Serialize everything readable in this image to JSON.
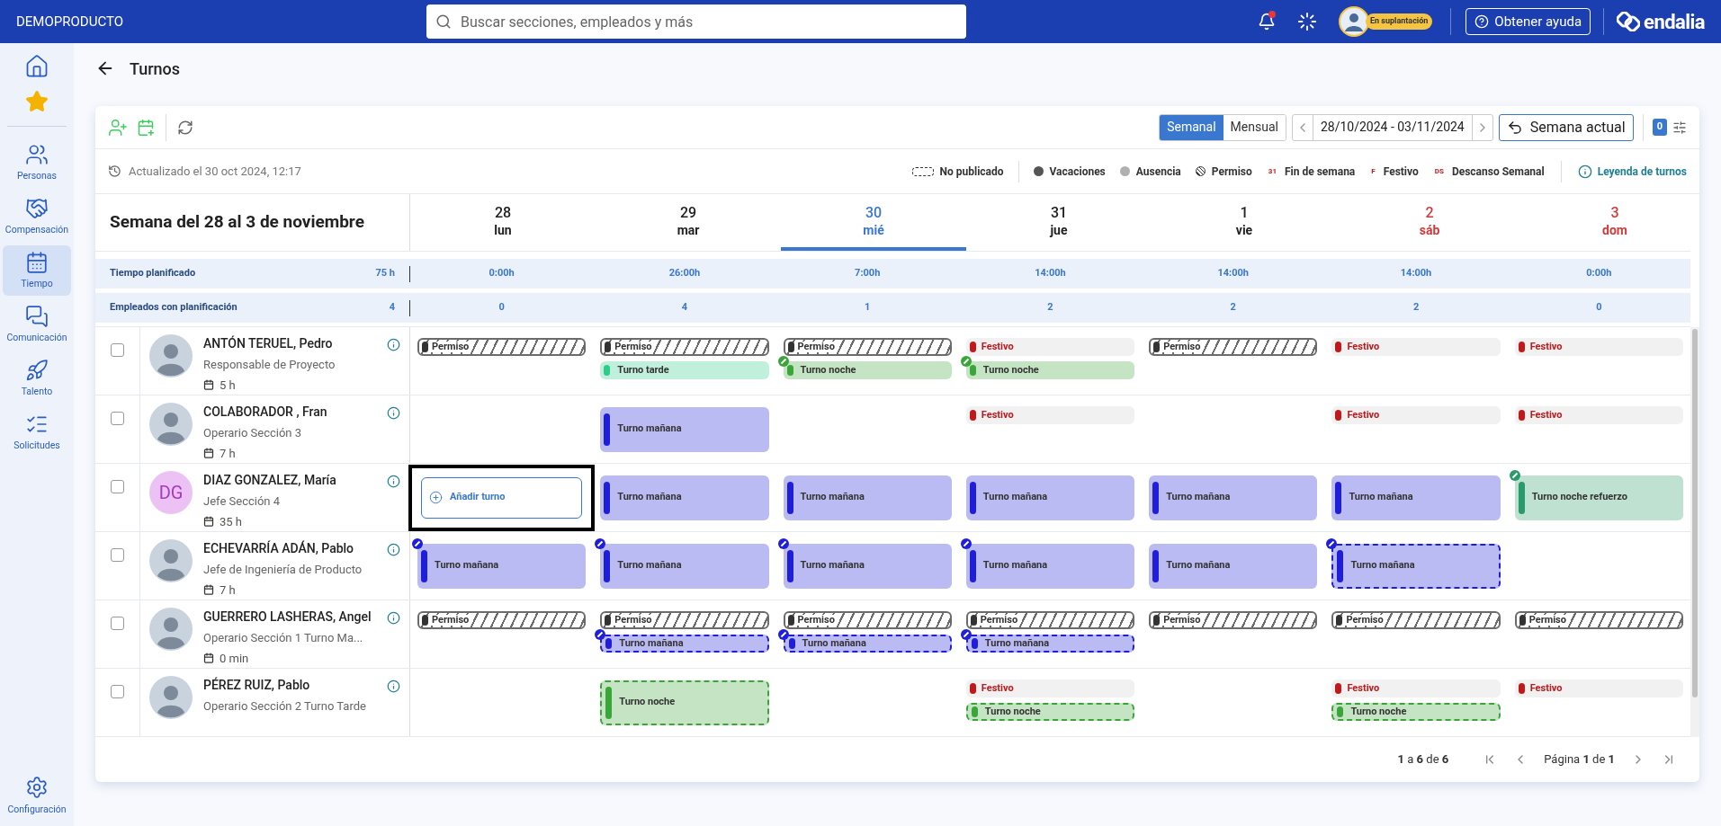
{
  "topbar": {
    "brand": "DEMOPRODUCTO",
    "search_placeholder": "Buscar secciones, empleados y más",
    "notifications": true,
    "impersonation_badge": "En suplantación",
    "help_button": "Obtener ayuda",
    "logo_text": "endalia"
  },
  "sidebar": {
    "items": [
      {
        "label": "Personas",
        "selected": false
      },
      {
        "label": "Compensación",
        "selected": false
      },
      {
        "label": "Tiempo",
        "selected": true
      },
      {
        "label": "Comunicación",
        "selected": false
      },
      {
        "label": "Talento",
        "selected": false
      },
      {
        "label": "Solicitudes",
        "selected": false
      }
    ],
    "footer": "Configuración"
  },
  "page": {
    "title": "Turnos"
  },
  "toolbar": {
    "views": [
      {
        "label": "Semanal",
        "selected": true
      },
      {
        "label": "Mensual",
        "selected": false
      }
    ],
    "date_range": "28/10/2024 - 03/11/2024",
    "current_week_button": "Semana actual",
    "filter_count": "0"
  },
  "updated": "Actualizado el 30 oct 2024, 12:17",
  "legend": [
    {
      "kind": "dashed",
      "label": "No publicado"
    },
    {
      "kind": "dot",
      "label": "Vacaciones",
      "color": "#555555"
    },
    {
      "kind": "dot",
      "label": "Ausencia",
      "color": "#b0b0b0"
    },
    {
      "kind": "hatch",
      "label": "Permiso"
    },
    {
      "kind": "mark",
      "mark": "31",
      "label": "Fin de semana"
    },
    {
      "kind": "mark",
      "mark": "F",
      "label": "Festivo"
    },
    {
      "kind": "mark",
      "mark": "DS",
      "label": "Descanso Semanal"
    }
  ],
  "legend_link": "Leyenda de turnos",
  "week": {
    "title": "Semana del 28 al 3 de noviembre",
    "days": [
      {
        "number": "28",
        "name": "lun",
        "today": false,
        "weekend": false
      },
      {
        "number": "29",
        "name": "mar",
        "today": false,
        "weekend": false
      },
      {
        "number": "30",
        "name": "mié",
        "today": true,
        "weekend": false
      },
      {
        "number": "31",
        "name": "jue",
        "today": false,
        "weekend": false
      },
      {
        "number": "1",
        "name": "vie",
        "today": false,
        "weekend": false
      },
      {
        "number": "2",
        "name": "sáb",
        "today": false,
        "weekend": true
      },
      {
        "number": "3",
        "name": "dom",
        "today": false,
        "weekend": true
      }
    ]
  },
  "stats": [
    {
      "label": "Tiempo planificado",
      "total": "75 h",
      "values": [
        "0:00h",
        "26:00h",
        "7:00h",
        "14:00h",
        "14:00h",
        "14:00h",
        "0:00h"
      ]
    },
    {
      "label": "Empleados con planificación",
      "total": "4",
      "values": [
        "0",
        "4",
        "1",
        "2",
        "2",
        "2",
        "0"
      ]
    }
  ],
  "employees": [
    {
      "name": "ANTÓN TERUEL, Pedro",
      "role": "Responsable de Proyecto",
      "hours": "5 h",
      "avatar": {
        "kind": "photo"
      },
      "checked": false,
      "days": {
        "day_1": [
          {
            "kind": "permiso",
            "label": "Permiso"
          }
        ],
        "day_2": [
          {
            "kind": "permiso",
            "label": "Permiso"
          },
          {
            "kind": "shift",
            "label": "Turno tarde",
            "color": "#2ecc8a",
            "published": true,
            "edited": false
          }
        ],
        "day_3": [
          {
            "kind": "permiso",
            "label": "Permiso"
          },
          {
            "kind": "shift",
            "label": "Turno noche",
            "color": "#3aa63a",
            "published": true,
            "edited": true
          }
        ],
        "day_4": [
          {
            "kind": "festivo",
            "label": "Festivo"
          },
          {
            "kind": "shift",
            "label": "Turno noche",
            "color": "#3aa63a",
            "published": true,
            "edited": true
          }
        ],
        "day_5": [
          {
            "kind": "permiso",
            "label": "Permiso"
          }
        ],
        "day_6": [
          {
            "kind": "festivo",
            "label": "Festivo"
          }
        ],
        "day_7": [
          {
            "kind": "festivo",
            "label": "Festivo"
          }
        ]
      }
    },
    {
      "name": "COLABORADOR , Fran",
      "role": "Operario Sección 3",
      "hours": "7 h",
      "avatar": {
        "kind": "photo"
      },
      "checked": false,
      "days": {
        "day_2": [
          {
            "kind": "shift",
            "label": "Turno mañana",
            "color": "#1f1fdb",
            "published": true,
            "edited": false
          }
        ],
        "day_4": [
          {
            "kind": "festivo",
            "label": "Festivo"
          }
        ],
        "day_6": [
          {
            "kind": "festivo",
            "label": "Festivo"
          }
        ],
        "day_7": [
          {
            "kind": "festivo",
            "label": "Festivo"
          }
        ]
      }
    },
    {
      "name": "DIAZ GONZALEZ, María",
      "role": "Jefe Sección 4",
      "hours": "35 h",
      "avatar": {
        "kind": "initials",
        "text": "DG"
      },
      "checked": false,
      "days": {
        "day_1": [
          {
            "kind": "add",
            "label": "Añadir turno",
            "focused": true
          }
        ],
        "day_2": [
          {
            "kind": "shift",
            "label": "Turno mañana",
            "color": "#1f1fdb",
            "published": true,
            "edited": false
          }
        ],
        "day_3": [
          {
            "kind": "shift",
            "label": "Turno mañana",
            "color": "#1f1fdb",
            "published": true,
            "edited": false
          }
        ],
        "day_4": [
          {
            "kind": "shift",
            "label": "Turno mañana",
            "color": "#1f1fdb",
            "published": true,
            "edited": false
          }
        ],
        "day_5": [
          {
            "kind": "shift",
            "label": "Turno mañana",
            "color": "#1f1fdb",
            "published": true,
            "edited": false
          }
        ],
        "day_6": [
          {
            "kind": "shift",
            "label": "Turno mañana",
            "color": "#1f1fdb",
            "published": true,
            "edited": false
          }
        ],
        "day_7": [
          {
            "kind": "shift",
            "label": "Turno noche refuerzo",
            "color": "#2a9a6a",
            "published": true,
            "edited": true
          }
        ]
      }
    },
    {
      "name": "ECHEVARRÍA ADÁN, Pablo",
      "role": "Jefe de Ingeniería de Producto",
      "hours": "7 h",
      "avatar": {
        "kind": "photo"
      },
      "checked": false,
      "days": {
        "day_1": [
          {
            "kind": "shift",
            "label": "Turno mañana",
            "color": "#1f1fdb",
            "published": true,
            "edited": true
          }
        ],
        "day_2": [
          {
            "kind": "shift",
            "label": "Turno mañana",
            "color": "#1f1fdb",
            "published": true,
            "edited": true
          }
        ],
        "day_3": [
          {
            "kind": "shift",
            "label": "Turno mañana",
            "color": "#1f1fdb",
            "published": true,
            "edited": true
          }
        ],
        "day_4": [
          {
            "kind": "shift",
            "label": "Turno mañana",
            "color": "#1f1fdb",
            "published": true,
            "edited": true
          }
        ],
        "day_5": [
          {
            "kind": "shift",
            "label": "Turno mañana",
            "color": "#1f1fdb",
            "published": true,
            "edited": false
          }
        ],
        "day_6": [
          {
            "kind": "shift",
            "label": "Turno mañana",
            "color": "#1f1fdb",
            "published": false,
            "edited": true
          }
        ]
      }
    },
    {
      "name": "GUERRERO LASHERAS, Angel",
      "role": "Operario Sección 1 Turno Ma...",
      "hours": "0 min",
      "avatar": {
        "kind": "photo"
      },
      "checked": false,
      "days": {
        "day_1": [
          {
            "kind": "permiso",
            "label": "Permiso"
          }
        ],
        "day_2": [
          {
            "kind": "permiso",
            "label": "Permiso"
          },
          {
            "kind": "shift",
            "label": "Turno mañana",
            "color": "#1f1fdb",
            "published": false,
            "edited": true
          }
        ],
        "day_3": [
          {
            "kind": "permiso",
            "label": "Permiso"
          },
          {
            "kind": "shift",
            "label": "Turno mañana",
            "color": "#1f1fdb",
            "published": false,
            "edited": true
          }
        ],
        "day_4": [
          {
            "kind": "permiso",
            "label": "Permiso"
          },
          {
            "kind": "shift",
            "label": "Turno mañana",
            "color": "#1f1fdb",
            "published": false,
            "edited": true
          }
        ],
        "day_5": [
          {
            "kind": "permiso",
            "label": "Permiso"
          }
        ],
        "day_6": [
          {
            "kind": "permiso",
            "label": "Permiso"
          }
        ],
        "day_7": [
          {
            "kind": "permiso",
            "label": "Permiso"
          }
        ]
      }
    },
    {
      "name": "PÉREZ RUIZ, Pablo",
      "role": "Operario Sección 2 Turno Tarde",
      "avatar": {
        "kind": "photo"
      },
      "checked": false,
      "days": {
        "day_2": [
          {
            "kind": "shift",
            "label": "Turno noche",
            "color": "#3aa63a",
            "published": false,
            "edited": false
          }
        ],
        "day_4": [
          {
            "kind": "festivo",
            "label": "Festivo"
          },
          {
            "kind": "shift",
            "label": "Turno noche",
            "color": "#3aa63a",
            "published": false,
            "edited": false
          }
        ],
        "day_6": [
          {
            "kind": "festivo",
            "label": "Festivo"
          },
          {
            "kind": "shift",
            "label": "Turno noche",
            "color": "#3aa63a",
            "published": false,
            "edited": false
          }
        ],
        "day_7": [
          {
            "kind": "festivo",
            "label": "Festivo"
          }
        ]
      }
    }
  ],
  "pagination": {
    "range": "**1** a **6** de **6**",
    "page": "Página **1** de **1**"
  }
}
